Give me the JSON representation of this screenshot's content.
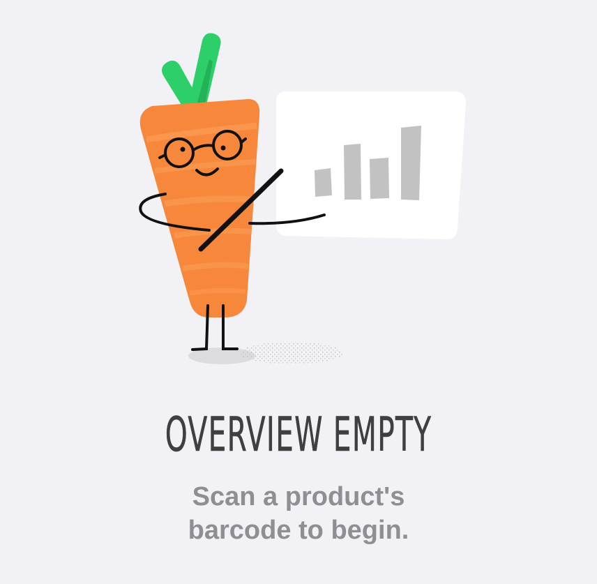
{
  "empty_state": {
    "title": "OVERVIEW EMPTY",
    "message_line_1": "Scan a product's",
    "message_line_2": "barcode to begin.",
    "illustration_icon": "carrot-mascot-presenting-chart"
  },
  "colors": {
    "background": "#f2f1f6",
    "carrot": "#f7873a",
    "carrot_stripe": "#fa9a52",
    "leaves": "#2dcf68",
    "leaves_dark": "#1a9a48",
    "board": "#ffffff",
    "bars": "#c4c4c4",
    "title_text": "#3f3f3f",
    "message_text": "#8e8e93"
  }
}
